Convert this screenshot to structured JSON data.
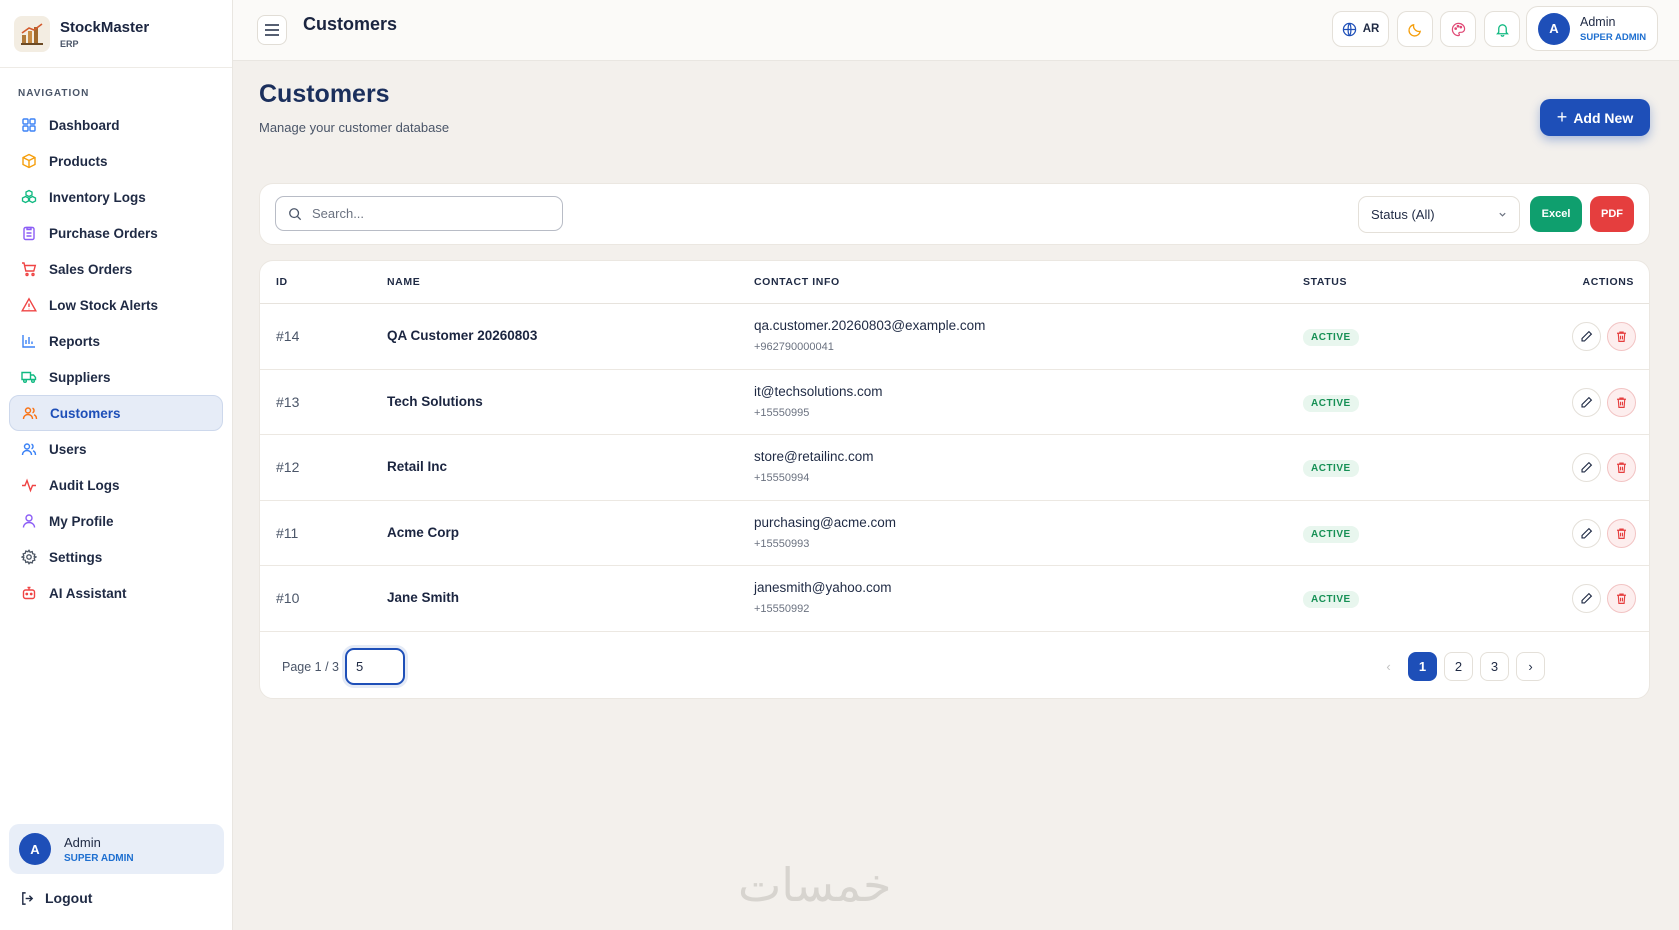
{
  "brand": {
    "name": "StockMaster",
    "sub": "ERP"
  },
  "nav": {
    "heading": "NAVIGATION",
    "items": [
      {
        "label": "Dashboard",
        "icon": "grid-icon",
        "color": "#3b82f6"
      },
      {
        "label": "Products",
        "icon": "box-icon",
        "color": "#f59e0b"
      },
      {
        "label": "Inventory Logs",
        "icon": "cubes-icon",
        "color": "#10b981"
      },
      {
        "label": "Purchase Orders",
        "icon": "clipboard-icon",
        "color": "#8b5cf6"
      },
      {
        "label": "Sales Orders",
        "icon": "cart-icon",
        "color": "#ef4444"
      },
      {
        "label": "Low Stock Alerts",
        "icon": "alert-triangle-icon",
        "color": "#ef4444"
      },
      {
        "label": "Reports",
        "icon": "bar-chart-icon",
        "color": "#3b82f6"
      },
      {
        "label": "Suppliers",
        "icon": "truck-icon",
        "color": "#10b981"
      },
      {
        "label": "Customers",
        "icon": "users-icon",
        "color": "#f97316"
      },
      {
        "label": "Users",
        "icon": "users-icon",
        "color": "#3b82f6"
      },
      {
        "label": "Audit Logs",
        "icon": "activity-icon",
        "color": "#ef4444"
      },
      {
        "label": "My Profile",
        "icon": "user-icon",
        "color": "#8b5cf6"
      },
      {
        "label": "Settings",
        "icon": "gear-icon",
        "color": "#4b5563"
      },
      {
        "label": "AI Assistant",
        "icon": "robot-icon",
        "color": "#ef4444"
      }
    ],
    "active_index": 8
  },
  "sidebar_user": {
    "initial": "A",
    "name": "Admin",
    "role": "SUPER ADMIN"
  },
  "logout_label": "Logout",
  "topbar": {
    "title": "Customers",
    "lang_label": "AR",
    "user": {
      "initial": "A",
      "name": "Admin",
      "role": "SUPER ADMIN"
    }
  },
  "page": {
    "title": "Customers",
    "subtitle": "Manage your customer database",
    "add_label": "Add New"
  },
  "filters": {
    "search_placeholder": "Search...",
    "status_selected": "Status (All)",
    "excel_label": "Excel",
    "pdf_label": "PDF"
  },
  "table": {
    "columns": [
      "ID",
      "NAME",
      "CONTACT INFO",
      "STATUS",
      "ACTIONS"
    ],
    "rows": [
      {
        "id": "#14",
        "name": "QA Customer 20260803",
        "email": "qa.customer.20260803@example.com",
        "phone": "+962790000041",
        "status": "ACTIVE"
      },
      {
        "id": "#13",
        "name": "Tech Solutions",
        "email": "it@techsolutions.com",
        "phone": "+15550995",
        "status": "ACTIVE"
      },
      {
        "id": "#12",
        "name": "Retail Inc",
        "email": "store@retailinc.com",
        "phone": "+15550994",
        "status": "ACTIVE"
      },
      {
        "id": "#11",
        "name": "Acme Corp",
        "email": "purchasing@acme.com",
        "phone": "+15550993",
        "status": "ACTIVE"
      },
      {
        "id": "#10",
        "name": "Jane Smith",
        "email": "janesmith@yahoo.com",
        "phone": "+15550992",
        "status": "ACTIVE"
      }
    ]
  },
  "pagination": {
    "info": "Page 1 / 3",
    "per_page": "5",
    "pages": [
      "1",
      "2",
      "3"
    ],
    "current": "1",
    "prev": "‹",
    "next": "›"
  },
  "watermark": "خمسات",
  "colors": {
    "primary": "#1e4fb8",
    "success": "#0f9f6e",
    "danger": "#e53e3e"
  }
}
